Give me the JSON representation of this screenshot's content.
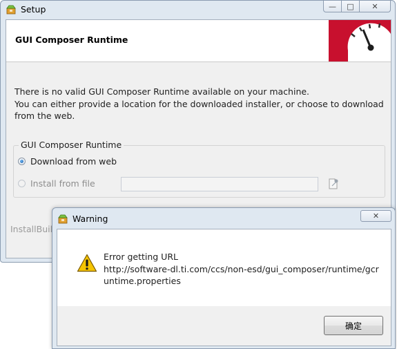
{
  "setup": {
    "title": "Setup",
    "caption_buttons": {
      "minimize": "—",
      "maximize": "□",
      "close": "✕"
    },
    "header_title": "GUI Composer Runtime",
    "intro_text": "There is no valid GUI Composer Runtime available on your machine.\nYou can either provide a location for the downloaded installer, or choose to download\nfrom the web.",
    "group": {
      "label": "GUI Composer Runtime",
      "options": [
        {
          "label": "Download from web",
          "checked": true,
          "enabled": true
        },
        {
          "label": "Install from file",
          "checked": false,
          "enabled": false
        }
      ],
      "file_path": ""
    },
    "footer_brand": "InstallBuild"
  },
  "warning": {
    "title": "Warning",
    "close_label": "✕",
    "message": "Error getting URL\nhttp://software-dl.ti.com/ccs/non-esd/gui_composer/runtime/gcr\nuntime.properties",
    "ok_label": "确定"
  },
  "colors": {
    "logo_red": "#c8102e",
    "window_frame": "#dfe8f1",
    "warning_yellow": "#f5c400"
  },
  "icons": {
    "app": "installer-box-icon",
    "logo": "speedometer-gauge-icon",
    "browse": "browse-file-icon",
    "warning": "warning-triangle-icon"
  }
}
